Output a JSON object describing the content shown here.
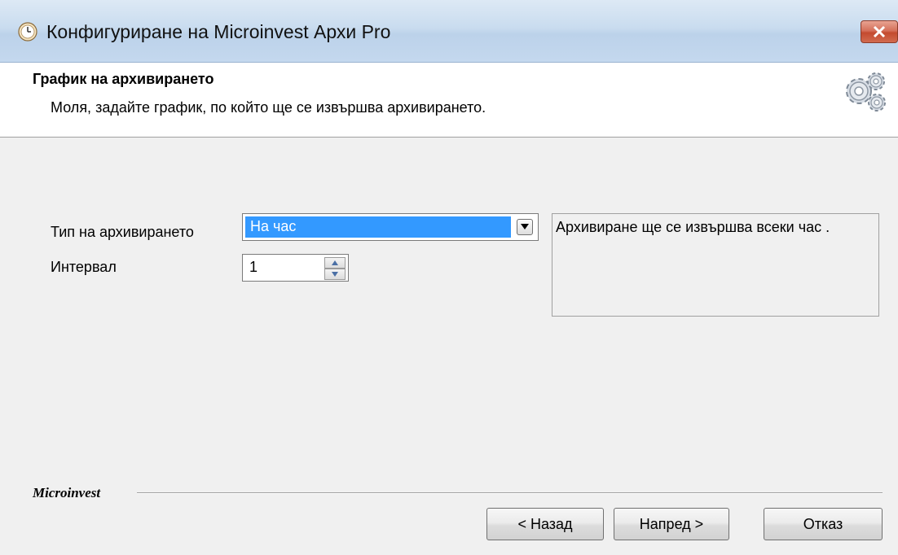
{
  "window": {
    "title": "Конфигуриране на Microinvest Архи Pro",
    "app_icon": "clock-icon",
    "close_icon": "close-icon"
  },
  "header": {
    "title": "График на архивирането",
    "subtitle": "Моля, задайте график, по който ще се извършва архивирането.",
    "icon": "gear-icon"
  },
  "form": {
    "archive_type_label": "Тип на архивирането",
    "archive_type_value": "На час",
    "interval_label": "Интервал",
    "interval_value": "1",
    "description": "Архивиране ще се извършва всеки час ."
  },
  "footer": {
    "brand": "Microinvest",
    "back_label": "< Назад",
    "next_label": "Напред >",
    "cancel_label": "Отказ"
  },
  "colors": {
    "selection": "#3399ff",
    "close_button": "#c44a2f",
    "background": "#f0f0f0"
  }
}
